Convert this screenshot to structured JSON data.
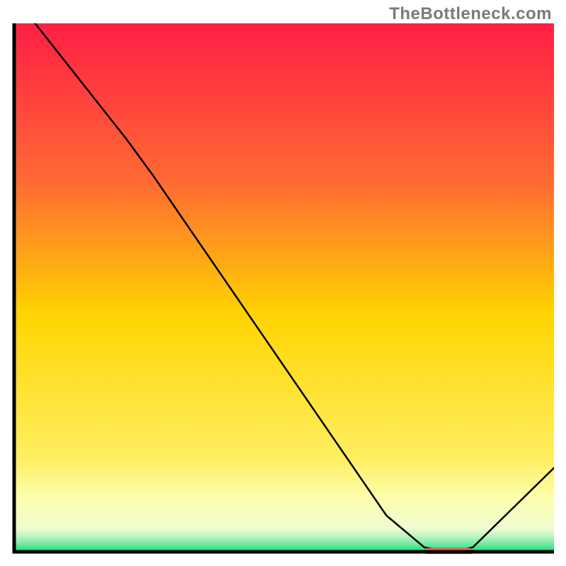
{
  "watermark": "TheBottleneck.com",
  "colors": {
    "grad_top": "#ff1f45",
    "grad_upper": "#ff6a33",
    "grad_mid": "#ffd400",
    "grad_lower1": "#ffee60",
    "grad_lower2": "#fcffb0",
    "grad_lower3": "#eefcd0",
    "grad_bottom": "#00e070",
    "axis": "#000000",
    "line": "#000000",
    "marker_fill": "#e9675a",
    "marker_stroke": "#d05040"
  },
  "chart_data": {
    "type": "line",
    "title": "",
    "xlabel": "",
    "ylabel": "",
    "xlim": [
      0,
      100
    ],
    "ylim": [
      0,
      100
    ],
    "grid": false,
    "x": [
      0,
      4,
      21,
      26,
      69,
      76,
      81,
      85,
      100
    ],
    "values": [
      102,
      100,
      78,
      71,
      7,
      1,
      0,
      1,
      16
    ],
    "marker": {
      "x_start": 76,
      "x_end": 85,
      "y": 0.3
    },
    "gradient_stops": [
      {
        "pct": 0,
        "band": "red"
      },
      {
        "pct": 30,
        "band": "orange"
      },
      {
        "pct": 55,
        "band": "yellow"
      },
      {
        "pct": 82,
        "band": "pale-yellow"
      },
      {
        "pct": 90,
        "band": "cream"
      },
      {
        "pct": 96,
        "band": "pale-green"
      },
      {
        "pct": 100,
        "band": "green"
      }
    ]
  }
}
